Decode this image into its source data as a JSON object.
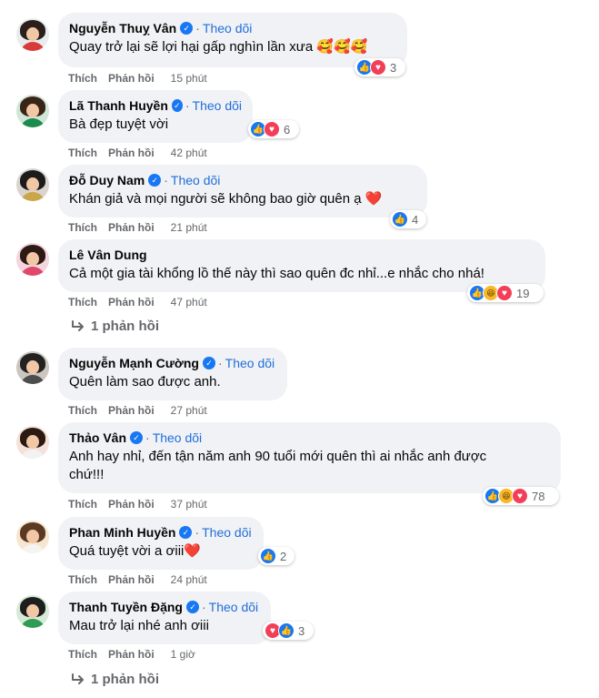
{
  "ui": {
    "follow_label": "Theo dõi",
    "like_label": "Thích",
    "reply_label": "Phản hồi",
    "separator": "·",
    "verified_mark": "✓"
  },
  "comments": [
    {
      "name": "Nguyễn Thuỵ Vân",
      "verified": true,
      "text": "Quay trở lại sẽ lợi hại gấp nghìn lần xưa",
      "emoji": "🥰🥰🥰",
      "time": "15 phút",
      "reactions": [
        "like",
        "love"
      ],
      "reaction_count": "3"
    },
    {
      "name": "Lã Thanh Huyền",
      "verified": true,
      "text": "Bà đẹp tuyệt vời",
      "time": "42 phút",
      "reactions": [
        "like",
        "love"
      ],
      "reaction_count": "6"
    },
    {
      "name": "Đỗ Duy Nam",
      "verified": true,
      "text": "Khán giả và mọi người sẽ không bao giờ quên ạ",
      "emoji": "❤️",
      "time": "21 phút",
      "reactions": [
        "like"
      ],
      "reaction_count": "4"
    },
    {
      "name": "Lê Vân Dung",
      "verified": false,
      "text": "Cả một gia tài khổng lồ thế này thì sao quên đc nhỉ...e nhắc cho nhá!",
      "time": "47 phút",
      "reactions": [
        "like",
        "haha",
        "love"
      ],
      "reaction_count": "19",
      "replies_label": "1 phản hồi"
    },
    {
      "name": "Nguyễn Mạnh Cường",
      "verified": true,
      "text": "Quên làm sao được anh.",
      "time": "27 phút"
    },
    {
      "name": "Thảo Vân",
      "verified": true,
      "text_line1": "Anh hay nhỉ, đến tận năm anh 90 tuổi mới quên thì ai nhắc anh được",
      "text_line2": "chứ!!!",
      "time": "37 phút",
      "reactions": [
        "like",
        "haha",
        "love"
      ],
      "reaction_count": "78"
    },
    {
      "name": "Phan Minh Huyền",
      "verified": true,
      "text": "Quá tuyệt vời a ơiii",
      "emoji": "❤️",
      "time": "24 phút",
      "reactions": [
        "like"
      ],
      "reaction_count": "2"
    },
    {
      "name": "Thanh Tuyền Đặng",
      "verified": true,
      "text": "Mau trở lại nhé anh ơiii",
      "time": "1 giờ",
      "reactions": [
        "love",
        "like"
      ],
      "reaction_count": "3",
      "replies_label": "1 phản hồi"
    }
  ]
}
